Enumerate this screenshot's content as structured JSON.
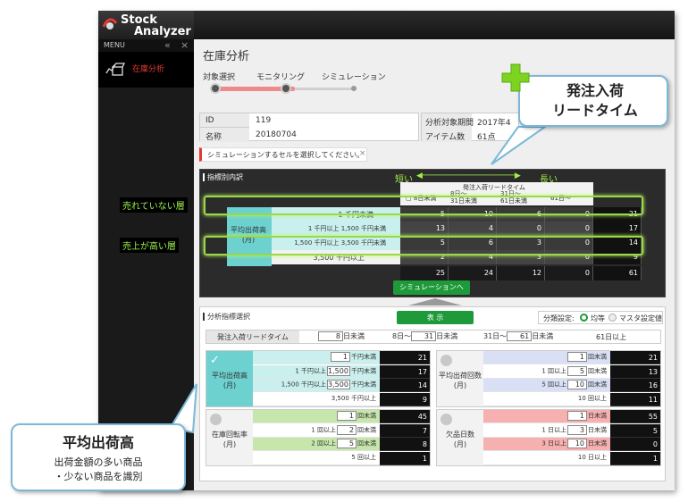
{
  "app": {
    "logo_line1": "Stock",
    "logo_line2": "Analyzer",
    "menu_label": "MENU",
    "menu_item": "在庫分析"
  },
  "page": {
    "title": "在庫分析",
    "steps": [
      "対象選択",
      "モニタリング",
      "シミュレーション"
    ],
    "info": {
      "id_label": "ID",
      "id_value": "119",
      "name_label": "名称",
      "name_value": "20180704",
      "period_label": "分析対象期間",
      "period_value": "2017年4",
      "items_label": "アイテム数",
      "items_value": "61点"
    },
    "alert": "シミュレーションするセルを選択してください。",
    "alert_close": "×"
  },
  "breakdown": {
    "title": "指標別内訳",
    "axis_short": "短い",
    "axis_long": "長い",
    "header_title": "発注入荷リードタイム",
    "col_headers": [
      "8日未満",
      "8日～\n31日未満",
      "31日～\n61日未満",
      "61日～"
    ],
    "row_group": "平均出荷高\n(月)",
    "row_labels": [
      "1 千円未満",
      "1 千円以上  1,500 千円未満",
      "1,500 千円以上  3,500 千円未満",
      "3,500 千円以上"
    ],
    "matrix": [
      [
        "5",
        "10",
        "6",
        "0",
        "21"
      ],
      [
        "13",
        "4",
        "0",
        "0",
        "17"
      ],
      [
        "5",
        "6",
        "3",
        "0",
        "14"
      ],
      [
        "2",
        "4",
        "3",
        "0",
        "9"
      ]
    ],
    "totals": [
      "25",
      "24",
      "12",
      "0",
      "61"
    ],
    "sim_button": "シミュレーションへ"
  },
  "selector": {
    "title": "分析指標選択",
    "show_button": "表 示",
    "class_label": "分類設定:",
    "radio_equal": "均等",
    "radio_master": "マスタ設定値",
    "lead_label": "発注入荷リードタイム",
    "lead_cells": [
      {
        "pre": "",
        "val": "8",
        "post": "日未満"
      },
      {
        "pre": "8日～",
        "val": "31",
        "post": "日未満"
      },
      {
        "pre": "31日～",
        "val": "61",
        "post": "日未満"
      },
      {
        "pre": "61日以上",
        "val": "",
        "post": ""
      }
    ],
    "panels": [
      {
        "name": "平均出荷高\n(月)",
        "rows": [
          {
            "a": "",
            "v1": "1",
            "b": "千円未満",
            "v2": "",
            "c": "",
            "n": "21"
          },
          {
            "a": "1 千円以上",
            "v1": "1,500",
            "b": "千円未満",
            "v2": "",
            "c": "",
            "n": "17"
          },
          {
            "a": "1,500 千円以上",
            "v1": "3,500",
            "b": "千円未満",
            "v2": "",
            "c": "",
            "n": "14"
          },
          {
            "a": "3,500 千円以上",
            "v1": "",
            "b": "",
            "v2": "",
            "c": "",
            "n": "9"
          }
        ]
      },
      {
        "name": "平均出荷回数\n(月)",
        "rows": [
          {
            "a": "",
            "v1": "1",
            "b": "回未満",
            "n": "21"
          },
          {
            "a": "1 回以上",
            "v1": "5",
            "b": "回未満",
            "n": "13"
          },
          {
            "a": "5 回以上",
            "v1": "10",
            "b": "回未満",
            "n": "16"
          },
          {
            "a": "10 回以上",
            "v1": "",
            "b": "",
            "n": "11"
          }
        ]
      },
      {
        "name": "在庫回転率\n(月)",
        "rows": [
          {
            "a": "",
            "v1": "1",
            "b": "回未満",
            "n": "45"
          },
          {
            "a": "1 回以上",
            "v1": "2",
            "b": "回未満",
            "n": "7"
          },
          {
            "a": "2 回以上",
            "v1": "5",
            "b": "回未満",
            "n": "8"
          },
          {
            "a": "5 回以上",
            "v1": "",
            "b": "",
            "n": "1"
          }
        ]
      },
      {
        "name": "欠品日数\n(月)",
        "rows": [
          {
            "a": "",
            "v1": "1",
            "b": "日未満",
            "n": "55"
          },
          {
            "a": "1 日以上",
            "v1": "3",
            "b": "日未満",
            "n": "5"
          },
          {
            "a": "3 日以上",
            "v1": "10",
            "b": "日未満",
            "n": "0"
          },
          {
            "a": "10 日以上",
            "v1": "",
            "b": "",
            "n": "1"
          }
        ]
      }
    ]
  },
  "annotations": {
    "top_right_title": "発注入荷\nリードタイム",
    "not_selling": "売れていない層",
    "high_sales": "売上が高い層",
    "bottom_left_title": "平均出荷高",
    "bottom_left_text": "出荷金額の多い商品\n・少ない商品を識別"
  },
  "colors": {
    "accent_green": "#1f9a3a",
    "cyan": "#6cd1cf",
    "highlight_green": "#9ad84a",
    "dark_cell": "#262626",
    "pink": "#f28a8a",
    "light_blue": "#c9d4ef",
    "light_green": "#b6dc95"
  }
}
